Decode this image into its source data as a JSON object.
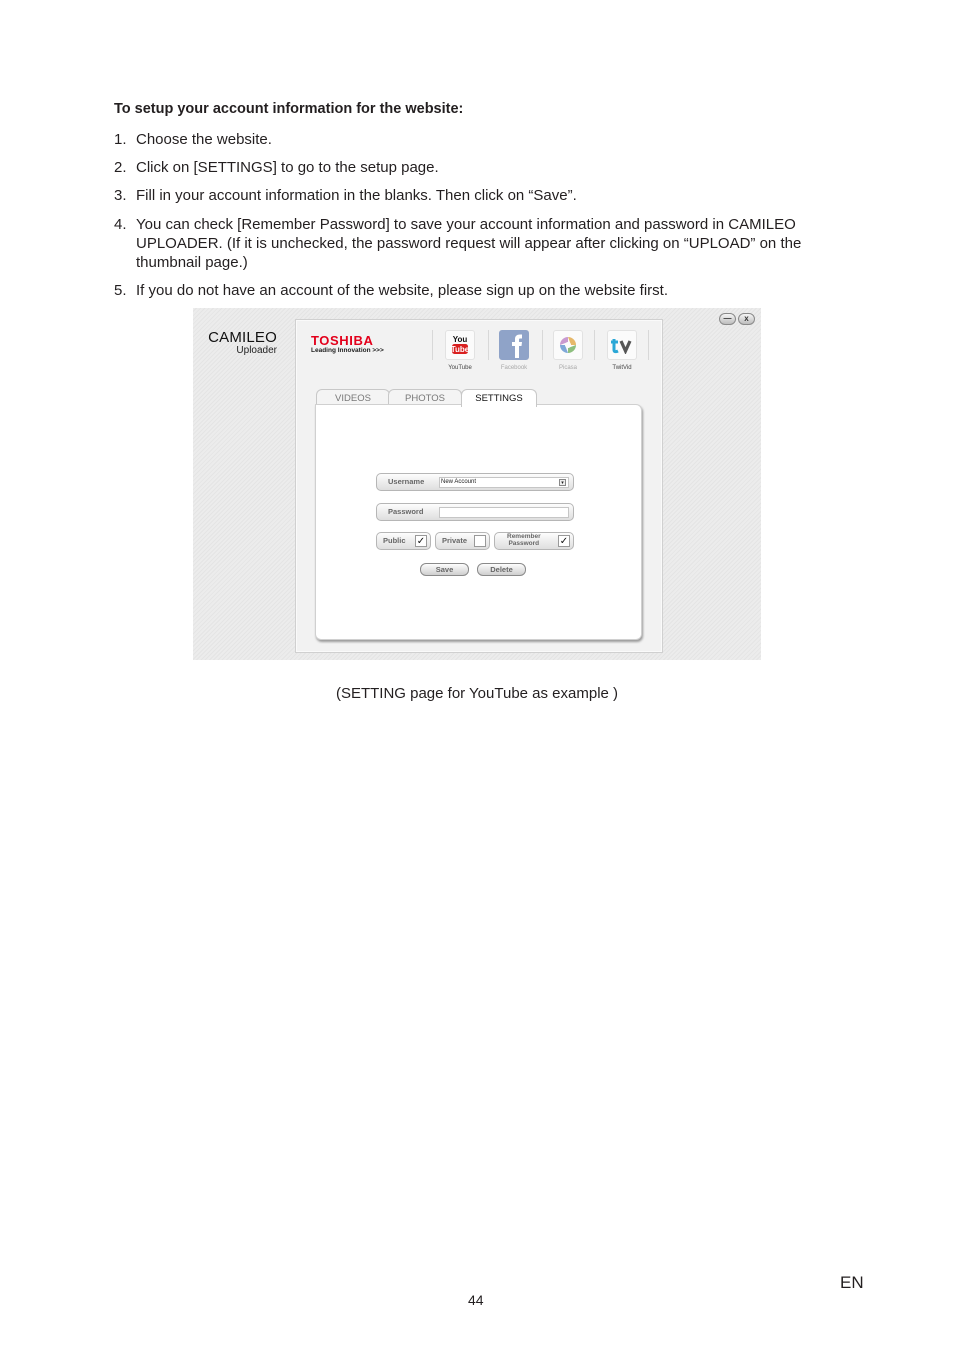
{
  "document": {
    "heading": "To setup your account information for the website:",
    "steps": [
      {
        "num": "1.",
        "text": "Choose the website."
      },
      {
        "num": "2.",
        "text": "Click on [SETTINGS] to go to the setup page."
      },
      {
        "num": "3.",
        "text": "Fill in your account information in the blanks. Then click on “Save”."
      },
      {
        "num": "4.",
        "text": "You can check [Remember Password] to save your account information and password in CAMILEO UPLOADER. (If it is unchecked, the password request will appear after clicking on “UPLOAD” on the thumbnail page.)"
      },
      {
        "num": "5.",
        "text": "If you do not have an account of the website, please sign up on the website first."
      }
    ],
    "caption": "(SETTING page for YouTube as example )",
    "page_number": "44",
    "language": "EN"
  },
  "app": {
    "brand_line1": "CAMILEO",
    "brand_line2": "Uploader",
    "minimize_label": "—",
    "close_label": "x",
    "toshiba_logo": "TOSHIBA",
    "toshiba_tagline": "Leading Innovation >>>",
    "sites": [
      {
        "name": "YouTube",
        "icon": "youtube-icon",
        "active": true
      },
      {
        "name": "Facebook",
        "icon": "facebook-icon",
        "active": false
      },
      {
        "name": "Picasa",
        "icon": "picasa-icon",
        "active": false
      },
      {
        "name": "TwitVid",
        "icon": "twitvid-icon",
        "active": false
      }
    ],
    "tabs": [
      {
        "label": "VIDEOS",
        "active": false
      },
      {
        "label": "PHOTOS",
        "active": false
      },
      {
        "label": "SETTINGS",
        "active": true
      }
    ],
    "settings": {
      "username_label": "Username",
      "username_value": "New Account",
      "password_label": "Password",
      "password_value": "",
      "public_label": "Public",
      "public_checked": true,
      "private_label": "Private",
      "private_checked": false,
      "remember_label_1": "Remember",
      "remember_label_2": "Password",
      "remember_checked": true,
      "check_mark": "✓",
      "save_label": "Save",
      "delete_label": "Delete"
    }
  },
  "colors": {
    "toshiba_red": "#e3001b",
    "youtube_red": "#d92020",
    "facebook_blue": "#8fa3c8",
    "twitvid_blue": "#2aa7d6"
  }
}
